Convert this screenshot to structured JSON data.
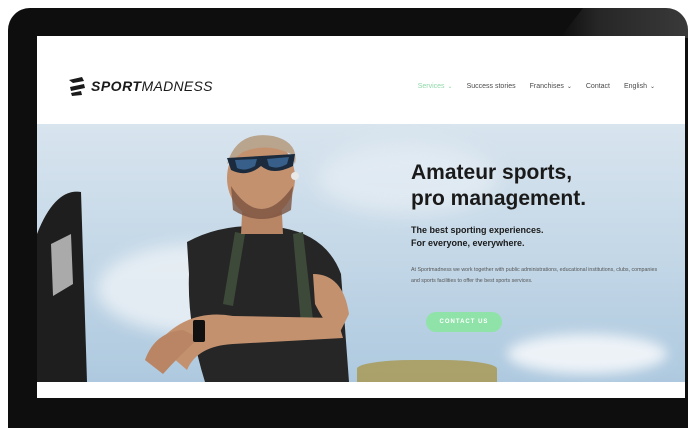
{
  "brand": {
    "logo_sport": "SPORT",
    "logo_madness": "MADNESS",
    "accent_color": "#8fe3a8"
  },
  "nav": {
    "items": [
      {
        "label": "Services",
        "has_dropdown": true,
        "active": true
      },
      {
        "label": "Success stories",
        "has_dropdown": false,
        "active": false
      },
      {
        "label": "Franchises",
        "has_dropdown": true,
        "active": false
      },
      {
        "label": "Contact",
        "has_dropdown": false,
        "active": false
      },
      {
        "label": "English",
        "has_dropdown": true,
        "active": false
      }
    ]
  },
  "hero": {
    "title_line1": "Amateur sports,",
    "title_line2": "pro management.",
    "subtitle_line1": "The best sporting experiences.",
    "subtitle_line2": "For everyone, everywhere.",
    "description": "At Sportmadness we work together with public administrations, educational institutions, clubs, companies and sports facilities to offer the best sports services.",
    "cta_label": "CONTACT US"
  }
}
